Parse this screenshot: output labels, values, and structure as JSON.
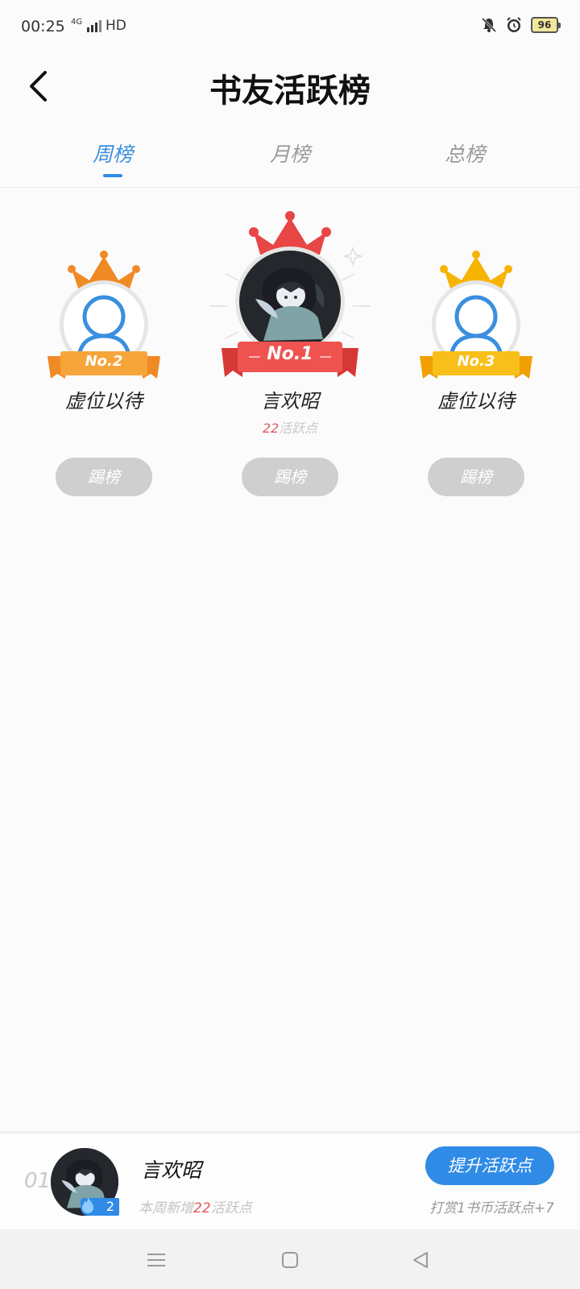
{
  "status": {
    "time": "00:25",
    "signal": "4G",
    "hd": "HD",
    "battery": "96"
  },
  "header": {
    "title": "书友活跃榜"
  },
  "tabs": [
    {
      "label": "周榜",
      "active": true
    },
    {
      "label": "月榜",
      "active": false
    },
    {
      "label": "总榜",
      "active": false
    }
  ],
  "podium": {
    "first": {
      "rank_label": "No.1",
      "name": "言欢昭",
      "points": "22",
      "points_suffix": "活跃点",
      "kick_label": "踢榜"
    },
    "second": {
      "rank_label": "No.2",
      "name": "虚位以待",
      "kick_label": "踢榜"
    },
    "third": {
      "rank_label": "No.3",
      "name": "虚位以待",
      "kick_label": "踢榜"
    }
  },
  "my_rank": {
    "rank": "01",
    "name": "言欢昭",
    "level": "2",
    "weekly_prefix": "本周新增",
    "weekly_points": "22",
    "weekly_suffix": "活跃点",
    "boost_label": "提升活跃点",
    "reward_tip": "打赏1书币活跃点+7"
  },
  "colors": {
    "accent": "#2f8be6",
    "gold_first": "#e84545",
    "gold_second": "#f08a24",
    "gold_third": "#f6b400",
    "points_red": "#e05a5a"
  }
}
